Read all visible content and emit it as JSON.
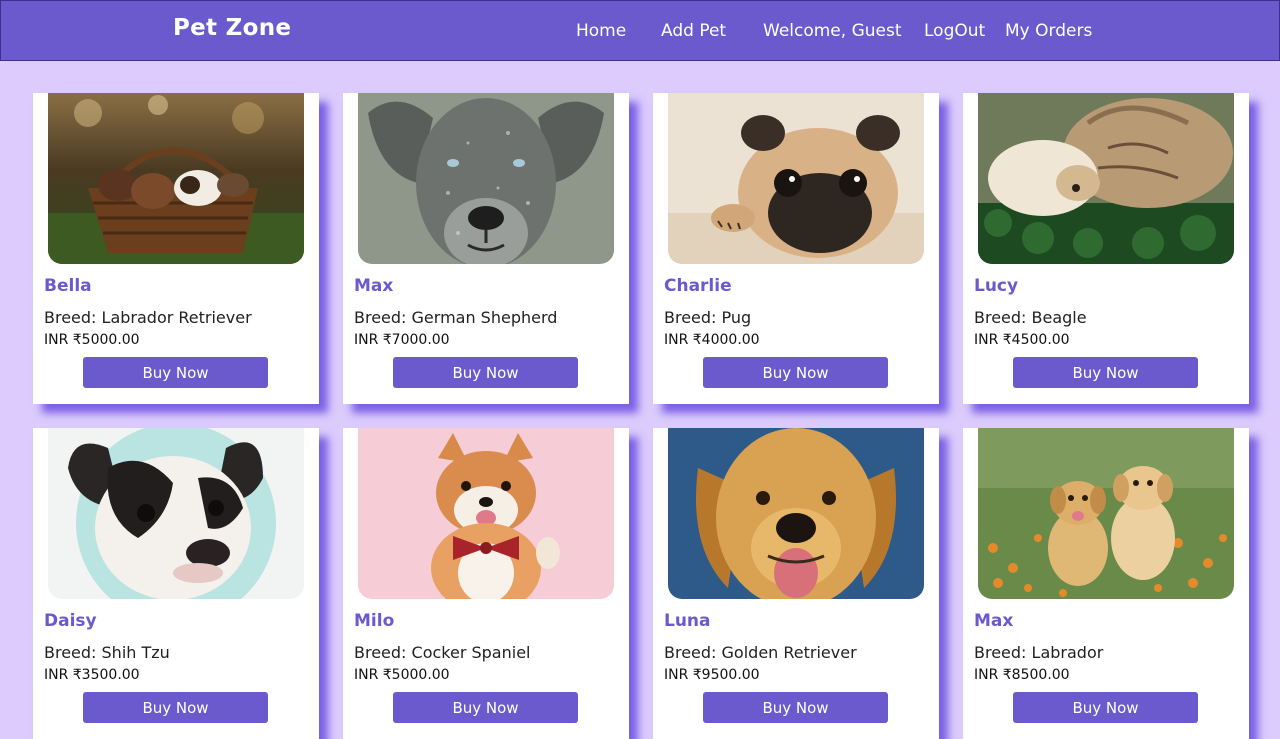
{
  "navbar": {
    "brand": "Pet Zone",
    "links": [
      "Home",
      "Add Pet",
      "Welcome, Guest",
      "LogOut",
      "My Orders"
    ]
  },
  "pets": [
    {
      "name": "Bella",
      "breed": "Breed: Labrador Retriever",
      "price": "INR ₹5000.00",
      "button": "Buy Now",
      "photo": "puppies-in-basket"
    },
    {
      "name": "Max",
      "breed": "Breed: German Shepherd",
      "price": "INR ₹7000.00",
      "button": "Buy Now",
      "photo": "grey-dog-portrait"
    },
    {
      "name": "Charlie",
      "breed": "Breed: Pug",
      "price": "INR ₹4000.00",
      "button": "Buy Now",
      "photo": "pug-lying"
    },
    {
      "name": "Lucy",
      "breed": "Breed: Beagle",
      "price": "INR ₹4500.00",
      "button": "Buy Now",
      "photo": "cat-and-dog-on-grass"
    },
    {
      "name": "Daisy",
      "breed": "Breed: Shih Tzu",
      "price": "INR ₹3500.00",
      "button": "Buy Now",
      "photo": "french-bulldog"
    },
    {
      "name": "Milo",
      "breed": "Breed: Cocker Spaniel",
      "price": "INR ₹5000.00",
      "button": "Buy Now",
      "photo": "shiba-with-bowtie"
    },
    {
      "name": "Luna",
      "breed": "Breed: Golden Retriever",
      "price": "INR ₹9500.00",
      "button": "Buy Now",
      "photo": "golden-retriever"
    },
    {
      "name": "Max",
      "breed": "Breed: Labrador",
      "price": "INR ₹8500.00",
      "button": "Buy Now",
      "photo": "two-puppies-flowers"
    }
  ],
  "colors": {
    "accent": "#6a5acd",
    "page_background": "#dccbfc",
    "card_shadow": "#5a3cdc"
  }
}
